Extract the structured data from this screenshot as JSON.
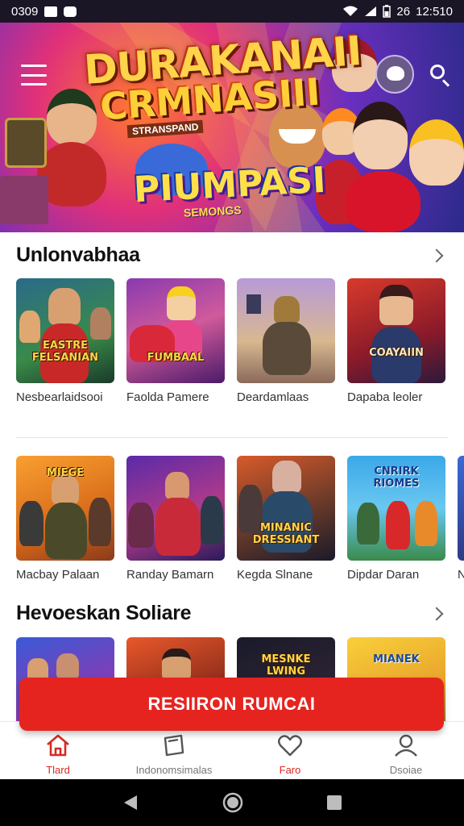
{
  "status_bar": {
    "time_left": "0309",
    "time_right": "12:510",
    "battery_text": "26"
  },
  "hero": {
    "title_line1": "DURAKANAII",
    "title_line2": "CRMNASIII",
    "tag": "STRANSPAND",
    "subtitle": "PIUMPASI",
    "subtitle_small": "SEMONGS"
  },
  "sections": [
    {
      "title": "Unlonvabhaa",
      "items": [
        {
          "label": "Nesbearlaidsooi",
          "art": "EASTRE FELSANIAN"
        },
        {
          "label": "Faolda Pamere",
          "art": "FUMBAAL"
        },
        {
          "label": "Deardamlaas",
          "art": ""
        },
        {
          "label": "Dapaba leoler",
          "art": "COAYAIIN"
        }
      ]
    },
    {
      "title": "",
      "items": [
        {
          "label": "Macbay Palaan",
          "art": "MIEGE"
        },
        {
          "label": "Randay Bamarn",
          "art": ""
        },
        {
          "label": "Kegda Slnane",
          "art": "MINANIC DRESSIANT"
        },
        {
          "label": "Dipdar Daran",
          "art": "CNRIRK RIOMES"
        },
        {
          "label": "Nu",
          "art": ""
        }
      ]
    },
    {
      "title": "Hevoeskan Soliare",
      "items": [
        {
          "label": "",
          "art": ""
        },
        {
          "label": "",
          "art": ""
        },
        {
          "label": "",
          "art": "MESNKE LWING"
        },
        {
          "label": "",
          "art": "MIANEK"
        }
      ]
    }
  ],
  "cta": {
    "label": "RESIIRON RUMCAI"
  },
  "bottom_nav": [
    {
      "label": "Tlard",
      "icon": "home-icon",
      "active": true
    },
    {
      "label": "Indonomsimalas",
      "icon": "shop-icon",
      "active": false
    },
    {
      "label": "Faro",
      "icon": "heart-icon",
      "active": false
    },
    {
      "label": "Dsoiae",
      "icon": "profile-icon",
      "active": false
    }
  ],
  "colors": {
    "accent": "#e52420",
    "active_nav": "#d62a23"
  }
}
